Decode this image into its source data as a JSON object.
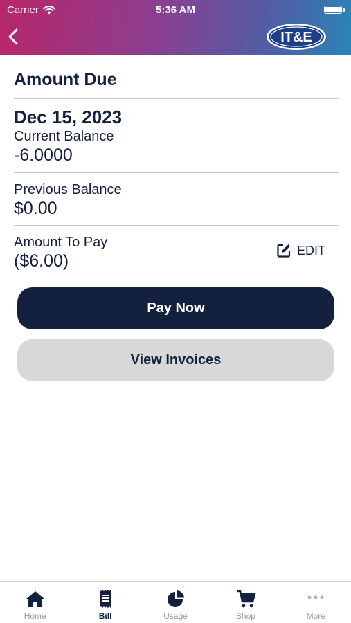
{
  "status_bar": {
    "carrier": "Carrier",
    "time": "5:36 AM"
  },
  "header": {
    "logo_text": "IT&E"
  },
  "bill": {
    "title": "Amount Due",
    "due_date": "Dec 15, 2023",
    "current_balance_label": "Current Balance",
    "current_balance_value": "-6.0000",
    "previous_balance_label": "Previous Balance",
    "previous_balance_value": "$0.00",
    "amount_to_pay_label": "Amount To Pay",
    "amount_to_pay_value": "($6.00)",
    "edit_label": "EDIT"
  },
  "actions": {
    "pay_now": "Pay Now",
    "view_invoices": "View Invoices"
  },
  "tabs": [
    {
      "label": "Home",
      "icon": "home-icon"
    },
    {
      "label": "Bill",
      "icon": "receipt-icon"
    },
    {
      "label": "Usage",
      "icon": "pie-chart-icon"
    },
    {
      "label": "Shop",
      "icon": "cart-icon"
    },
    {
      "label": "More",
      "icon": "more-icon"
    }
  ],
  "active_tab": "Bill",
  "colors": {
    "navy": "#13213f",
    "gray_button": "#d8d8d8",
    "inactive_tab": "#9a9a9a"
  }
}
